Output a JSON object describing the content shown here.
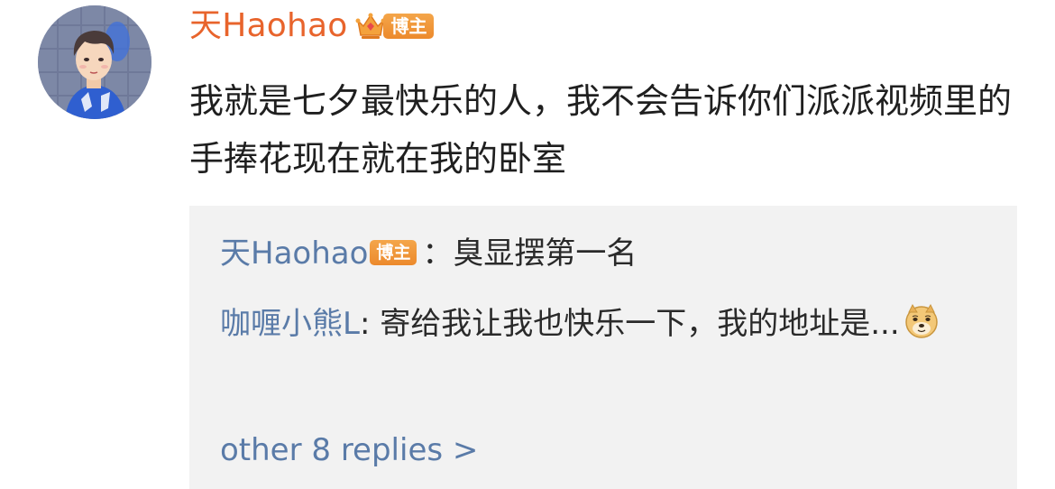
{
  "comment": {
    "author": "天Haohao",
    "badge": "博主",
    "text": "我就是七夕最快乐的人，我不会告诉你们派派视频里的手捧花现在就在我的卧室"
  },
  "replies": [
    {
      "author": "天Haohao",
      "badge": "博主",
      "separator": "：",
      "text": "臭显摆第一名"
    },
    {
      "author": "咖喱小熊L",
      "separator": ": ",
      "text": "寄给我让我也快乐一下，我的地址是...",
      "emoji": "doge-emoji"
    }
  ],
  "more_replies_label": "other 8 replies >",
  "colors": {
    "author_name": "#e8642c",
    "reply_author": "#5a7ba8",
    "badge": "#f09a3a",
    "reply_background": "#f2f2f2",
    "text": "#1f1f1f"
  },
  "icons": {
    "crown": "crown-icon",
    "avatar": "avatar-image"
  }
}
